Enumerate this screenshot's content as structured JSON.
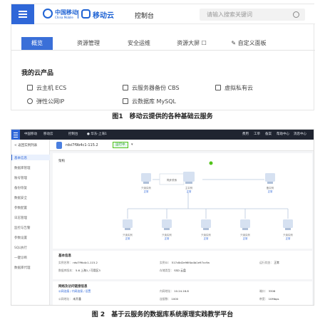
{
  "figure1": {
    "brand": "中国移动",
    "brand_sub": "China Mobile",
    "cloud_name": "移动云",
    "console": "控制台",
    "search_placeholder": "请输入搜索关键词",
    "tabs": [
      "概览",
      "资源管理",
      "安全运维",
      "资源大屏 ☐",
      "自定义面板"
    ],
    "active_tab": "概览",
    "section_title": "我的云产品",
    "products": [
      {
        "icon": "server-icon",
        "label": "云主机 ECS"
      },
      {
        "icon": "backup-icon",
        "label": "云服务器备份 CBS"
      },
      {
        "icon": "vpc-icon",
        "label": "虚拟私有云"
      },
      {
        "icon": "eip-icon",
        "label": "弹性公网IP"
      },
      {
        "icon": "database-icon",
        "label": "云数据库 MySQL"
      }
    ],
    "caption": "图1　移动云提供的各种基础云服务"
  },
  "figure2": {
    "top_bar": {
      "brand": "中国移动",
      "cloud_name": "移动云",
      "console": "控制台",
      "region": "● 华东-上海1",
      "right_items": [
        "费用",
        "工单",
        "备案",
        "帮助中心",
        "消息中心"
      ]
    },
    "sidebar": {
      "back_label": "< 返回实例列表",
      "items": [
        "基本信息",
        "数据库管理",
        "账号管理",
        "备份恢复",
        "数据安全",
        "参数配置",
        "日志管理",
        "监控与告警",
        "参数设置",
        "SQL执行",
        "一键诊断",
        "数据库代理"
      ],
      "active": "基本信息"
    },
    "header": {
      "instance_name": "rdsi7f9b4c1-115.2",
      "status": "运行中"
    },
    "architecture": {
      "title": "架构",
      "nodes": [
        {
          "name": "只读实例",
          "status": "正常"
        },
        {
          "name": "主实例",
          "status": "正常"
        },
        {
          "name": "备实例",
          "status": "正常"
        },
        {
          "name": "只读实例",
          "status": "正常"
        },
        {
          "name": "只读实例",
          "status": "正常"
        },
        {
          "name": "只读实例",
          "status": "正常"
        },
        {
          "name": "只读实例",
          "status": "正常"
        },
        {
          "name": "只读实例",
          "status": "正常"
        }
      ],
      "sync_label": "同步关系"
    },
    "basic_info": {
      "title": "基本信息",
      "rows": [
        [
          "实例名称",
          "rdsi7f9b4c1-115.2"
        ],
        [
          "实例ID",
          "517c8d2e96f4a4b1e97cc9a"
        ],
        [
          "运行状态",
          "正常"
        ],
        [
          "数据库版本",
          "5.6 上海1 / 可用区3"
        ],
        [
          "存储类型",
          "SSD 云盘"
        ]
      ]
    },
    "connection": {
      "title": "网络及访问链接信息",
      "tabs": "公网连接 / 内网连接 / 设置",
      "rows": [
        [
          "内网地址",
          "10.24.16.8"
        ],
        [
          "端口",
          "3306"
        ],
        [
          "公网地址",
          "未开通"
        ],
        [
          "连接数",
          "1000"
        ],
        [
          "带宽",
          "10Mbps"
        ]
      ]
    },
    "caption": "图 2　基于云服务的数据库系统原理实践教学平台"
  }
}
